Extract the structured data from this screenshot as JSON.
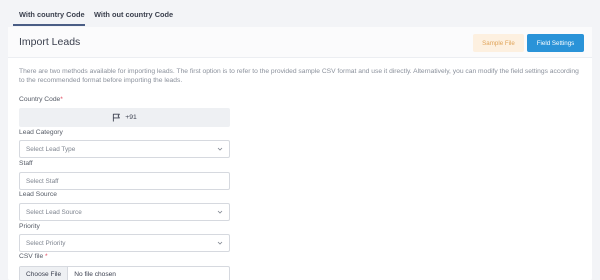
{
  "tabs": [
    {
      "label": "With country Code"
    },
    {
      "label": "With out country Code"
    }
  ],
  "header": {
    "title": "Import Leads",
    "sample_file_label": "Sample File",
    "field_settings_label": "Field Settings"
  },
  "description": "There are two methods available for importing leads. The first option is to refer to the provided sample CSV format and use it directly. Alternatively, you can modify the field settings according to the recommended format before importing the leads.",
  "form": {
    "country_code": {
      "label": "Country Code",
      "required": "*",
      "value": "+91",
      "icon": "flag-icon"
    },
    "lead_category": {
      "label": "Lead Category",
      "placeholder": "Select Lead Type",
      "icon": "chevron-down-icon"
    },
    "staff": {
      "label": "Staff",
      "placeholder": "Select Staff"
    },
    "lead_source": {
      "label": "Lead Source",
      "placeholder": "Select Lead Source",
      "icon": "chevron-down-icon"
    },
    "priority": {
      "label": "Priority",
      "placeholder": "Select Priority",
      "icon": "chevron-down-icon"
    },
    "csv_file": {
      "label": "CSV file",
      "required": "*",
      "button_label": "Choose File",
      "status": "No file chosen"
    }
  },
  "colors": {
    "accent": "#2a93d8",
    "sample_bg": "#fdf0e0",
    "sample_text": "#e0a45a",
    "tab_underline": "#4a5d85",
    "required": "#e0455a"
  }
}
